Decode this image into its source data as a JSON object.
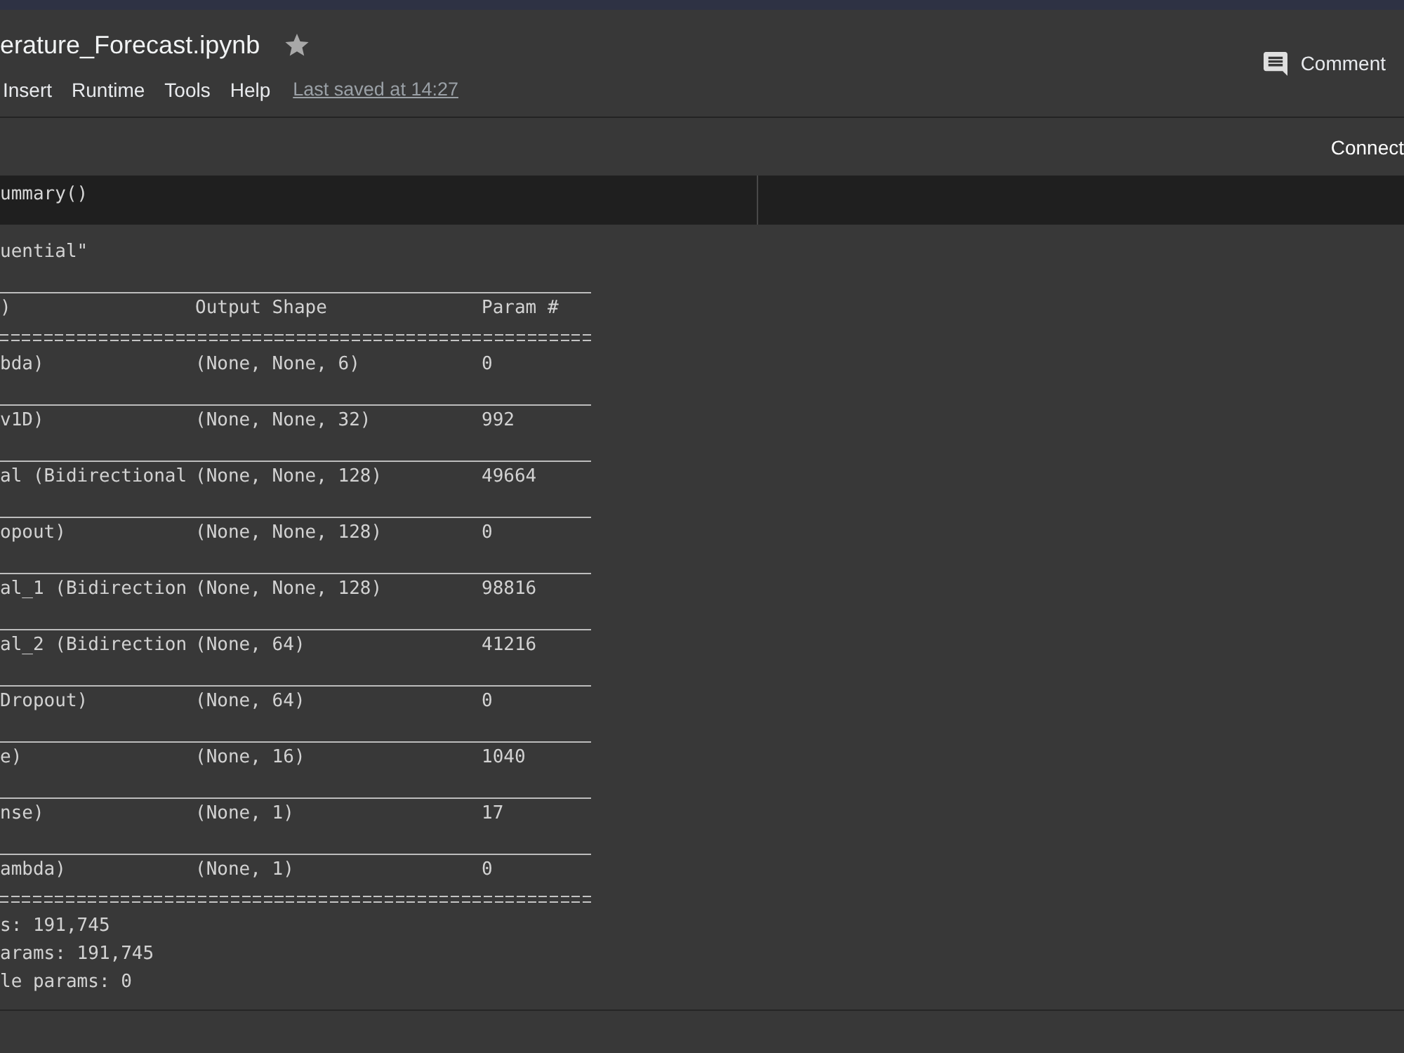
{
  "notebook": {
    "title": "erature_Forecast.ipynb"
  },
  "menu": [
    {
      "label": "Insert"
    },
    {
      "label": "Runtime"
    },
    {
      "label": "Tools"
    },
    {
      "label": "Help"
    }
  ],
  "last_saved": "Last saved at 14:27",
  "comment_button": {
    "label": "Comment"
  },
  "toolbar": {
    "connect_button": {
      "label": "Connect"
    }
  },
  "code_cell": {
    "code": "ummary()"
  },
  "output": {
    "heading": "uential\"",
    "table": {
      "columns": [
        ")",
        "Output Shape",
        "Param #"
      ],
      "rows": [
        [
          "bda)",
          "(None, None, 6)",
          "0"
        ],
        [
          "v1D)",
          "(None, None, 32)",
          "992"
        ],
        [
          "al (Bidirectional",
          "(None, None, 128)",
          "49664"
        ],
        [
          "opout)",
          "(None, None, 128)",
          "0"
        ],
        [
          "al_1 (Bidirection",
          "(None, None, 128)",
          "98816"
        ],
        [
          "al_2 (Bidirection",
          "(None, 64)",
          "41216"
        ],
        [
          "Dropout)",
          "(None, 64)",
          "0"
        ],
        [
          "e)",
          "(None, 16)",
          "1040"
        ],
        [
          "nse)",
          "(None, 1)",
          "17"
        ],
        [
          "ambda)",
          "(None, 1)",
          "0"
        ]
      ]
    },
    "totals": [
      "s: 191,745",
      "arams: 191,745",
      "le params: 0"
    ]
  }
}
